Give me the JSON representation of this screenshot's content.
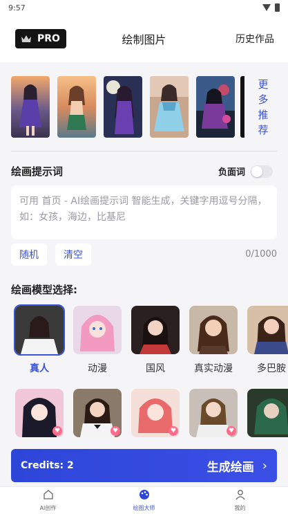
{
  "status": {
    "time": "9:57"
  },
  "header": {
    "pro_label": "PRO",
    "title": "绘制图片",
    "history_label": "历史作品"
  },
  "samples": {
    "more_label": [
      "更",
      "多",
      "推",
      "荐"
    ]
  },
  "prompt": {
    "title": "绘画提示词",
    "negative_label": "负面词",
    "negative_enabled": false,
    "placeholder": "可用 首页 - AI绘画提示词 智能生成，关键字用逗号分隔，如：女孩，海边，比基尼",
    "random_label": "随机",
    "clear_label": "清空",
    "counter": "0/1000"
  },
  "models": {
    "title": "绘画模型选择:",
    "row1": [
      {
        "name": "真人",
        "selected": true
      },
      {
        "name": "动漫"
      },
      {
        "name": "国风"
      },
      {
        "name": "真实动漫"
      },
      {
        "name": "多巴胺"
      }
    ]
  },
  "generate": {
    "credits": "Credits: 2",
    "label": "生成绘画"
  },
  "tabbar": {
    "tabs": [
      {
        "label": "AI创作",
        "icon": "home-icon"
      },
      {
        "label": "绘图大师",
        "icon": "palette-icon",
        "active": true
      },
      {
        "label": "我的",
        "icon": "person-icon"
      }
    ]
  },
  "colors": {
    "accent": "#3a52d6",
    "pro_bg": "#141414",
    "bg": "#f5f5f7"
  }
}
